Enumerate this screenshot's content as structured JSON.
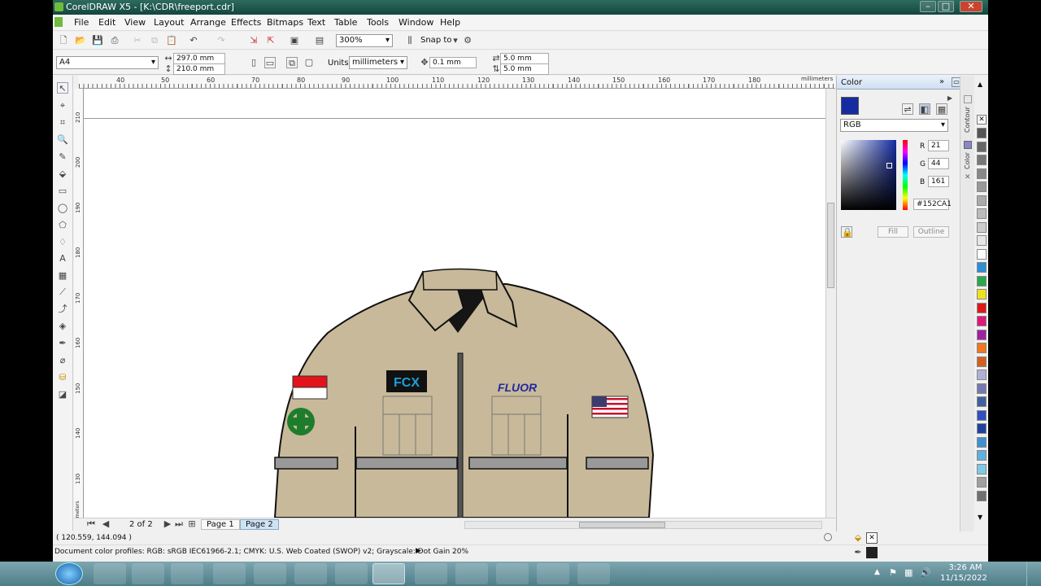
{
  "window": {
    "title": "CorelDRAW X5 - [K:\\CDR\\freeport.cdr]"
  },
  "menu": [
    "File",
    "Edit",
    "View",
    "Layout",
    "Arrange",
    "Effects",
    "Bitmaps",
    "Text",
    "Table",
    "Tools",
    "Window",
    "Help"
  ],
  "toolbar": {
    "zoom": "300%",
    "snap_label": "Snap to"
  },
  "propbar": {
    "page_size": "A4",
    "width": "297.0 mm",
    "height": "210.0 mm",
    "units_label": "Units:",
    "units": "millimeters",
    "nudge": "0.1 mm",
    "dup_x": "5.0 mm",
    "dup_y": "5.0 mm"
  },
  "ruler": {
    "h_ticks": [
      "40",
      "50",
      "60",
      "70",
      "80",
      "90",
      "100",
      "110",
      "120",
      "130",
      "140",
      "150",
      "160",
      "170",
      "180"
    ],
    "h_unit": "millimeters",
    "v_ticks": [
      "210",
      "200",
      "190",
      "180",
      "170",
      "160",
      "150",
      "140",
      "130"
    ],
    "v_unit": "millimeters"
  },
  "artwork": {
    "logo_text": "FCX",
    "brand_text": "FLUOR"
  },
  "pages": {
    "counter": "2 of 2",
    "tabs": [
      "Page 1",
      "Page 2"
    ]
  },
  "status": {
    "coords": "( 120.559, 144.094 )",
    "profiles": "Document color profiles: RGB: sRGB IEC61966-2.1; CMYK: U.S. Web Coated (SWOP) v2; Grayscale: Dot Gain 20%"
  },
  "docker": {
    "title": "Color",
    "model": "RGB",
    "r_label": "R",
    "r": "21",
    "g_label": "G",
    "g": "44",
    "b_label": "B",
    "b": "161",
    "hex": "#152CA1",
    "fill_btn": "Fill",
    "outline_btn": "Outline",
    "swatch": "#152CA1",
    "tabs": [
      "Contour",
      "Color"
    ]
  },
  "palette_colors": [
    "#555555",
    "#666666",
    "#777777",
    "#888888",
    "#999999",
    "#aaaaaa",
    "#bbbbbb",
    "#cccccc",
    "#e6e6e6",
    "#ffffff",
    "#2a8fd6",
    "#2aa84a",
    "#f0e020",
    "#e01818",
    "#e0187a",
    "#a020a0",
    "#f07820",
    "#d46020",
    "#b0b0d8",
    "#7878b0",
    "#4060a0",
    "#3050c0",
    "#2040a0",
    "#4090d0",
    "#60b0e0",
    "#80c8e8",
    "#a0a0a0",
    "#707070"
  ],
  "taskbar": {
    "time": "3:26 AM",
    "date": "11/15/2022"
  },
  "colors": {
    "jacket": "#c8b99a",
    "title_bg": "#1f5a4e"
  }
}
